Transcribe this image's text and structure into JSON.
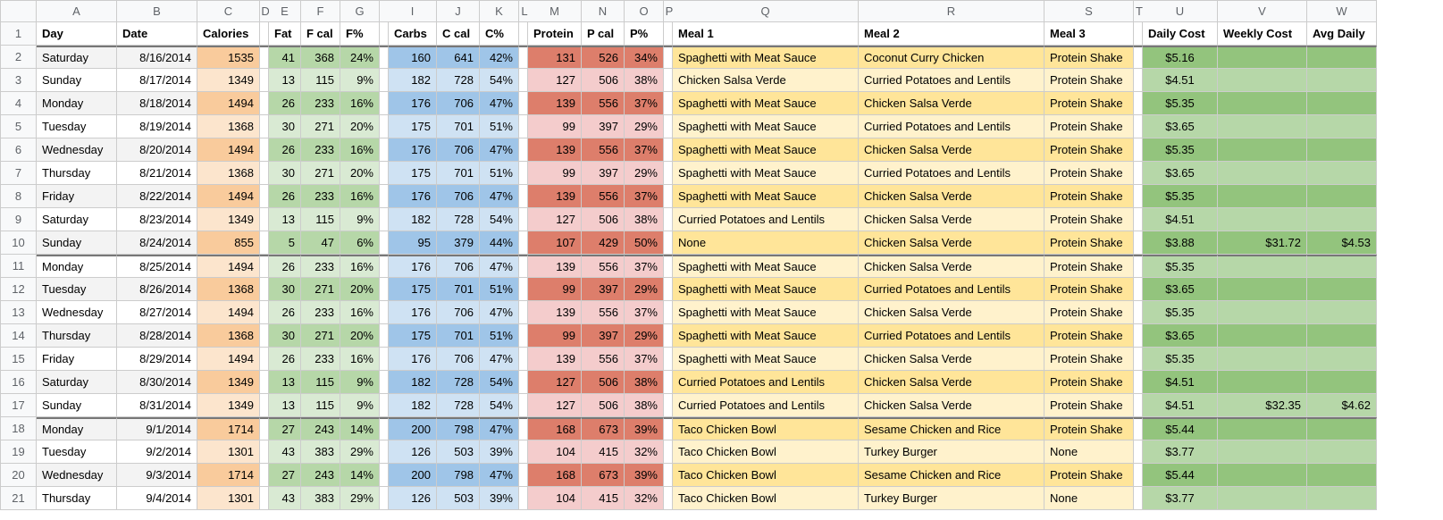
{
  "columns_letters": [
    "",
    "A",
    "B",
    "C",
    "D",
    "E",
    "F",
    "G",
    "",
    "I",
    "J",
    "K",
    "L",
    "M",
    "N",
    "O",
    "P",
    "Q",
    "R",
    "S",
    "T",
    "U",
    "V",
    "W"
  ],
  "headers": {
    "day": "Day",
    "date": "Date",
    "cal": "Calories",
    "fat": "Fat",
    "fcal": "F cal",
    "fpct": "F%",
    "carbs": "Carbs",
    "ccal": "C cal",
    "cpct": "C%",
    "protein": "Protein",
    "pcal": "P cal",
    "ppct": "P%",
    "m1": "Meal 1",
    "m2": "Meal 2",
    "m3": "Meal 3",
    "dcost": "Daily Cost",
    "wcost": "Weekly Cost",
    "avg": "Avg Daily"
  },
  "rows": [
    {
      "n": 2,
      "shade": "a",
      "day": "Saturday",
      "date": "8/16/2014",
      "cal": 1535,
      "fat": 41,
      "fcal": 368,
      "fpct": "24%",
      "carbs": 160,
      "ccal": 641,
      "cpct": "42%",
      "pro": 131,
      "pcal": 526,
      "ppct": "34%",
      "m1": "Spaghetti with Meat Sauce",
      "m2": "Coconut Curry Chicken",
      "m3": "Protein Shake",
      "dc": "$5.16",
      "wc": "",
      "ad": ""
    },
    {
      "n": 3,
      "shade": "b",
      "day": "Sunday",
      "date": "8/17/2014",
      "cal": 1349,
      "fat": 13,
      "fcal": 115,
      "fpct": "9%",
      "carbs": 182,
      "ccal": 728,
      "cpct": "54%",
      "pro": 127,
      "pcal": 506,
      "ppct": "38%",
      "m1": "Chicken Salsa Verde",
      "m2": "Curried Potatoes and Lentils",
      "m3": "Protein Shake",
      "dc": "$4.51",
      "wc": "",
      "ad": ""
    },
    {
      "n": 4,
      "shade": "a",
      "day": "Monday",
      "date": "8/18/2014",
      "cal": 1494,
      "fat": 26,
      "fcal": 233,
      "fpct": "16%",
      "carbs": 176,
      "ccal": 706,
      "cpct": "47%",
      "pro": 139,
      "pcal": 556,
      "ppct": "37%",
      "m1": "Spaghetti with Meat Sauce",
      "m2": "Chicken Salsa Verde",
      "m3": "Protein Shake",
      "dc": "$5.35",
      "wc": "",
      "ad": ""
    },
    {
      "n": 5,
      "shade": "b",
      "day": "Tuesday",
      "date": "8/19/2014",
      "cal": 1368,
      "fat": 30,
      "fcal": 271,
      "fpct": "20%",
      "carbs": 175,
      "ccal": 701,
      "cpct": "51%",
      "pro": 99,
      "pcal": 397,
      "ppct": "29%",
      "m1": "Spaghetti with Meat Sauce",
      "m2": "Curried Potatoes and Lentils",
      "m3": "Protein Shake",
      "dc": "$3.65",
      "wc": "",
      "ad": ""
    },
    {
      "n": 6,
      "shade": "a",
      "day": "Wednesday",
      "date": "8/20/2014",
      "cal": 1494,
      "fat": 26,
      "fcal": 233,
      "fpct": "16%",
      "carbs": 176,
      "ccal": 706,
      "cpct": "47%",
      "pro": 139,
      "pcal": 556,
      "ppct": "37%",
      "m1": "Spaghetti with Meat Sauce",
      "m2": "Chicken Salsa Verde",
      "m3": "Protein Shake",
      "dc": "$5.35",
      "wc": "",
      "ad": ""
    },
    {
      "n": 7,
      "shade": "b",
      "day": "Thursday",
      "date": "8/21/2014",
      "cal": 1368,
      "fat": 30,
      "fcal": 271,
      "fpct": "20%",
      "carbs": 175,
      "ccal": 701,
      "cpct": "51%",
      "pro": 99,
      "pcal": 397,
      "ppct": "29%",
      "m1": "Spaghetti with Meat Sauce",
      "m2": "Curried Potatoes and Lentils",
      "m3": "Protein Shake",
      "dc": "$3.65",
      "wc": "",
      "ad": ""
    },
    {
      "n": 8,
      "shade": "a",
      "day": "Friday",
      "date": "8/22/2014",
      "cal": 1494,
      "fat": 26,
      "fcal": 233,
      "fpct": "16%",
      "carbs": 176,
      "ccal": 706,
      "cpct": "47%",
      "pro": 139,
      "pcal": 556,
      "ppct": "37%",
      "m1": "Spaghetti with Meat Sauce",
      "m2": "Chicken Salsa Verde",
      "m3": "Protein Shake",
      "dc": "$5.35",
      "wc": "",
      "ad": ""
    },
    {
      "n": 9,
      "shade": "b",
      "day": "Saturday",
      "date": "8/23/2014",
      "cal": 1349,
      "fat": 13,
      "fcal": 115,
      "fpct": "9%",
      "carbs": 182,
      "ccal": 728,
      "cpct": "54%",
      "pro": 127,
      "pcal": 506,
      "ppct": "38%",
      "m1": "Curried Potatoes and Lentils",
      "m2": "Chicken Salsa Verde",
      "m3": "Protein Shake",
      "dc": "$4.51",
      "wc": "",
      "ad": ""
    },
    {
      "n": 10,
      "shade": "a",
      "day": "Sunday",
      "date": "8/24/2014",
      "cal": 855,
      "fat": 5,
      "fcal": 47,
      "fpct": "6%",
      "carbs": 95,
      "ccal": 379,
      "cpct": "44%",
      "pro": 107,
      "pcal": 429,
      "ppct": "50%",
      "m1": "None",
      "m2": "Chicken Salsa Verde",
      "m3": "Protein Shake",
      "dc": "$3.88",
      "wc": "$31.72",
      "ad": "$4.53",
      "thick_after": true
    },
    {
      "n": 11,
      "shade": "b",
      "day": "Monday",
      "date": "8/25/2014",
      "cal": 1494,
      "fat": 26,
      "fcal": 233,
      "fpct": "16%",
      "carbs": 176,
      "ccal": 706,
      "cpct": "47%",
      "pro": 139,
      "pcal": 556,
      "ppct": "37%",
      "m1": "Spaghetti with Meat Sauce",
      "m2": "Chicken Salsa Verde",
      "m3": "Protein Shake",
      "dc": "$5.35",
      "wc": "",
      "ad": ""
    },
    {
      "n": 12,
      "shade": "a",
      "day": "Tuesday",
      "date": "8/26/2014",
      "cal": 1368,
      "fat": 30,
      "fcal": 271,
      "fpct": "20%",
      "carbs": 175,
      "ccal": 701,
      "cpct": "51%",
      "pro": 99,
      "pcal": 397,
      "ppct": "29%",
      "m1": "Spaghetti with Meat Sauce",
      "m2": "Curried Potatoes and Lentils",
      "m3": "Protein Shake",
      "dc": "$3.65",
      "wc": "",
      "ad": ""
    },
    {
      "n": 13,
      "shade": "b",
      "day": "Wednesday",
      "date": "8/27/2014",
      "cal": 1494,
      "fat": 26,
      "fcal": 233,
      "fpct": "16%",
      "carbs": 176,
      "ccal": 706,
      "cpct": "47%",
      "pro": 139,
      "pcal": 556,
      "ppct": "37%",
      "m1": "Spaghetti with Meat Sauce",
      "m2": "Chicken Salsa Verde",
      "m3": "Protein Shake",
      "dc": "$5.35",
      "wc": "",
      "ad": ""
    },
    {
      "n": 14,
      "shade": "a",
      "day": "Thursday",
      "date": "8/28/2014",
      "cal": 1368,
      "fat": 30,
      "fcal": 271,
      "fpct": "20%",
      "carbs": 175,
      "ccal": 701,
      "cpct": "51%",
      "pro": 99,
      "pcal": 397,
      "ppct": "29%",
      "m1": "Spaghetti with Meat Sauce",
      "m2": "Curried Potatoes and Lentils",
      "m3": "Protein Shake",
      "dc": "$3.65",
      "wc": "",
      "ad": ""
    },
    {
      "n": 15,
      "shade": "b",
      "day": "Friday",
      "date": "8/29/2014",
      "cal": 1494,
      "fat": 26,
      "fcal": 233,
      "fpct": "16%",
      "carbs": 176,
      "ccal": 706,
      "cpct": "47%",
      "pro": 139,
      "pcal": 556,
      "ppct": "37%",
      "m1": "Spaghetti with Meat Sauce",
      "m2": "Chicken Salsa Verde",
      "m3": "Protein Shake",
      "dc": "$5.35",
      "wc": "",
      "ad": ""
    },
    {
      "n": 16,
      "shade": "a",
      "day": "Saturday",
      "date": "8/30/2014",
      "cal": 1349,
      "fat": 13,
      "fcal": 115,
      "fpct": "9%",
      "carbs": 182,
      "ccal": 728,
      "cpct": "54%",
      "pro": 127,
      "pcal": 506,
      "ppct": "38%",
      "m1": "Curried Potatoes and Lentils",
      "m2": "Chicken Salsa Verde",
      "m3": "Protein Shake",
      "dc": "$4.51",
      "wc": "",
      "ad": ""
    },
    {
      "n": 17,
      "shade": "b",
      "day": "Sunday",
      "date": "8/31/2014",
      "cal": 1349,
      "fat": 13,
      "fcal": 115,
      "fpct": "9%",
      "carbs": 182,
      "ccal": 728,
      "cpct": "54%",
      "pro": 127,
      "pcal": 506,
      "ppct": "38%",
      "m1": "Curried Potatoes and Lentils",
      "m2": "Chicken Salsa Verde",
      "m3": "Protein Shake",
      "dc": "$4.51",
      "wc": "$32.35",
      "ad": "$4.62",
      "thick_after": true
    },
    {
      "n": 18,
      "shade": "a",
      "day": "Monday",
      "date": "9/1/2014",
      "cal": 1714,
      "fat": 27,
      "fcal": 243,
      "fpct": "14%",
      "carbs": 200,
      "ccal": 798,
      "cpct": "47%",
      "pro": 168,
      "pcal": 673,
      "ppct": "39%",
      "m1": "Taco Chicken Bowl",
      "m2": "Sesame Chicken and Rice",
      "m3": "Protein Shake",
      "dc": "$5.44",
      "wc": "",
      "ad": ""
    },
    {
      "n": 19,
      "shade": "b",
      "day": "Tuesday",
      "date": "9/2/2014",
      "cal": 1301,
      "fat": 43,
      "fcal": 383,
      "fpct": "29%",
      "carbs": 126,
      "ccal": 503,
      "cpct": "39%",
      "pro": 104,
      "pcal": 415,
      "ppct": "32%",
      "m1": "Taco Chicken Bowl",
      "m2": "Turkey Burger",
      "m3": "None",
      "dc": "$3.77",
      "wc": "",
      "ad": ""
    },
    {
      "n": 20,
      "shade": "a",
      "day": "Wednesday",
      "date": "9/3/2014",
      "cal": 1714,
      "fat": 27,
      "fcal": 243,
      "fpct": "14%",
      "carbs": 200,
      "ccal": 798,
      "cpct": "47%",
      "pro": 168,
      "pcal": 673,
      "ppct": "39%",
      "m1": "Taco Chicken Bowl",
      "m2": "Sesame Chicken and Rice",
      "m3": "Protein Shake",
      "dc": "$5.44",
      "wc": "",
      "ad": ""
    },
    {
      "n": 21,
      "shade": "b",
      "day": "Thursday",
      "date": "9/4/2014",
      "cal": 1301,
      "fat": 43,
      "fcal": 383,
      "fpct": "29%",
      "carbs": 126,
      "ccal": 503,
      "cpct": "39%",
      "pro": 104,
      "pcal": 415,
      "ppct": "32%",
      "m1": "Taco Chicken Bowl",
      "m2": "Turkey Burger",
      "m3": "None",
      "dc": "$3.77",
      "wc": "",
      "ad": ""
    }
  ]
}
